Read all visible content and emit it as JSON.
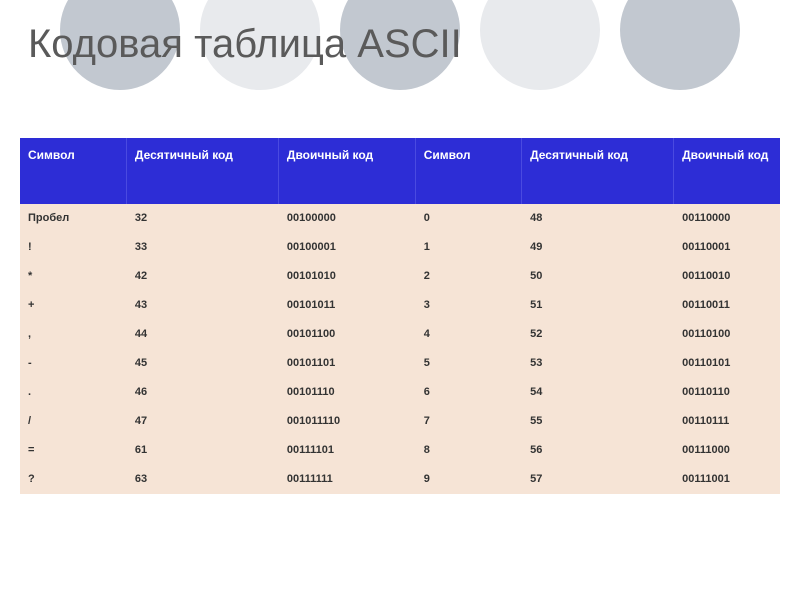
{
  "title": "Кодовая таблица ASCII",
  "headers": {
    "symbol1": "Символ",
    "dec1": "Десятичный код",
    "bin1": "Двоичный код",
    "symbol2": "Символ",
    "dec2": "Десятичный код",
    "bin2": "Двоичный код"
  },
  "rows": [
    {
      "s1": "Пробел",
      "d1": "32",
      "b1": "00100000",
      "s2": "0",
      "d2": "48",
      "b2": "00110000"
    },
    {
      "s1": "!",
      "d1": "33",
      "b1": "00100001",
      "s2": "1",
      "d2": "49",
      "b2": "00110001"
    },
    {
      "s1": "*",
      "d1": "42",
      "b1": "00101010",
      "s2": "2",
      "d2": "50",
      "b2": "00110010"
    },
    {
      "s1": "+",
      "d1": "43",
      "b1": "00101011",
      "s2": "3",
      "d2": "51",
      "b2": "00110011"
    },
    {
      "s1": ",",
      "d1": "44",
      "b1": "00101100",
      "s2": "4",
      "d2": "52",
      "b2": "00110100"
    },
    {
      "s1": "-",
      "d1": "45",
      "b1": "00101101",
      "s2": "5",
      "d2": "53",
      "b2": "00110101"
    },
    {
      "s1": ".",
      "d1": "46",
      "b1": "00101110",
      "s2": "6",
      "d2": "54",
      "b2": "00110110"
    },
    {
      "s1": "/",
      "d1": "47",
      "b1": "001011110",
      "s2": "7",
      "d2": "55",
      "b2": "00110111"
    },
    {
      "s1": "=",
      "d1": "61",
      "b1": "00111101",
      "s2": "8",
      "d2": "56",
      "b2": "00111000"
    },
    {
      "s1": "?",
      "d1": "63",
      "b1": "00111111",
      "s2": "9",
      "d2": "57",
      "b2": "00111001"
    }
  ],
  "chart_data": {
    "type": "table",
    "title": "Кодовая таблица ASCII",
    "columns": [
      "Символ",
      "Десятичный код",
      "Двоичный код",
      "Символ",
      "Десятичный код",
      "Двоичный код"
    ],
    "data": [
      [
        "Пробел",
        "32",
        "00100000",
        "0",
        "48",
        "00110000"
      ],
      [
        "!",
        "33",
        "00100001",
        "1",
        "49",
        "00110001"
      ],
      [
        "*",
        "42",
        "00101010",
        "2",
        "50",
        "00110010"
      ],
      [
        "+",
        "43",
        "00101011",
        "3",
        "51",
        "00110011"
      ],
      [
        ",",
        "44",
        "00101100",
        "4",
        "52",
        "00110100"
      ],
      [
        "-",
        "45",
        "00101101",
        "5",
        "53",
        "00110101"
      ],
      [
        ".",
        "46",
        "00101110",
        "6",
        "54",
        "00110110"
      ],
      [
        "/",
        "47",
        "001011110",
        "7",
        "55",
        "00110111"
      ],
      [
        "=",
        "61",
        "00111101",
        "8",
        "56",
        "00111000"
      ],
      [
        "?",
        "63",
        "00111111",
        "9",
        "57",
        "00111001"
      ]
    ]
  }
}
